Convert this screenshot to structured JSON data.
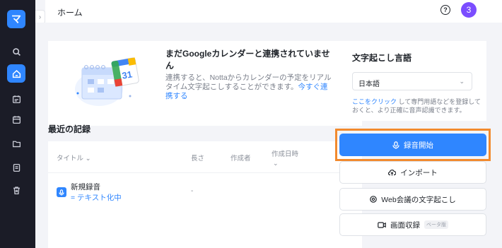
{
  "sidebar": {
    "logo": "マ",
    "items": [
      {
        "icon": "search-icon"
      },
      {
        "icon": "home-icon",
        "active": true
      },
      {
        "icon": "calendar-check-icon"
      },
      {
        "icon": "calendar-icon"
      },
      {
        "icon": "folder-icon"
      },
      {
        "icon": "note-icon"
      },
      {
        "icon": "trash-icon"
      }
    ]
  },
  "header": {
    "title": "ホーム",
    "help": "?",
    "avatar": "3"
  },
  "banner": {
    "title": "まだGoogleカレンダーと連携されていません",
    "body": "連携すると、Nottaからカレンダーの予定をリアルタイム文字起こしすることができます。",
    "link": "今すぐ連携する",
    "calendar_day": "31"
  },
  "records": {
    "title": "最近の記録",
    "columns": {
      "title": "タイトル ⌄",
      "length": "長さ",
      "creator": "作成者",
      "created": "作成日時",
      "created_sort": "⌄"
    },
    "rows": [
      {
        "name": "新規録音",
        "status": "= テキスト化中",
        "length": "-"
      }
    ]
  },
  "language_panel": {
    "title": "文字起こし言語",
    "selected": "日本語",
    "note_link": "ここをクリック",
    "note": "して専門用語などを登録しておくと、より正確に音声認識できます。"
  },
  "actions": {
    "record": "録音開始",
    "import": "インポート",
    "web_meeting": "Web会議の文字起こし",
    "screen_record": "画面収録",
    "beta": "ベータ版"
  },
  "colors": {
    "accent": "#2f86ff",
    "highlight": "#f28a2e",
    "avatar": "#7b4dff",
    "sidebar": "#1b1c27"
  }
}
